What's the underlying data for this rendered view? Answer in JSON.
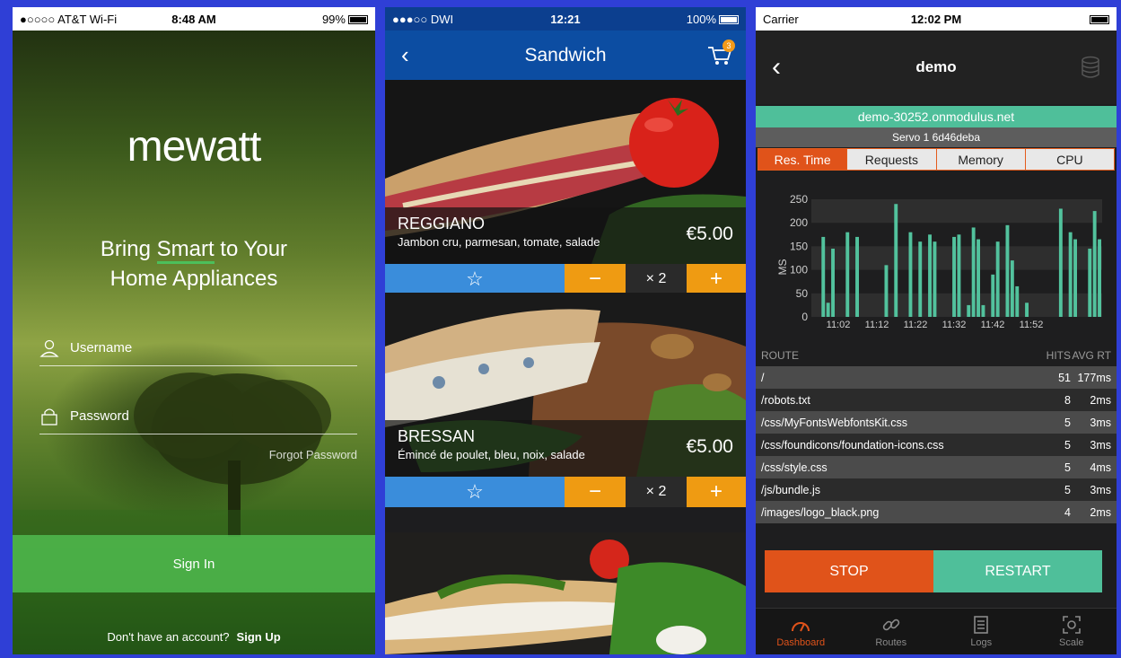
{
  "colors": {
    "background": "#2f3fd6",
    "mewatt_green": "#4cbf5b",
    "sandwich_blue": "#0c4da2",
    "sandwich_orange": "#ef9b12",
    "modulus_orange": "#e0531a",
    "modulus_teal": "#4fbf9a"
  },
  "mewatt": {
    "status": {
      "carrier": "●○○○○ AT&T Wi-Fi",
      "time": "8:48 AM",
      "battery": "99%"
    },
    "logo": "mewatt",
    "tagline_line1_pre": "Bring ",
    "tagline_highlight": "Smart",
    "tagline_line1_post": " to Your",
    "tagline_line2": "Home Appliances",
    "username_placeholder": "Username",
    "password_placeholder": "Password",
    "forgot": "Forgot Password",
    "signin": "Sign In",
    "signup_prompt": "Don't have an account?",
    "signup_link": "Sign Up"
  },
  "sandwich": {
    "status": {
      "carrier": "●●●○○ DWI",
      "time": "12:21",
      "battery": "100%"
    },
    "title": "Sandwich",
    "cart_count": "3",
    "products": [
      {
        "name": "REGGIANO",
        "desc": "Jambon cru, parmesan, tomate, salade",
        "price": "€5.00",
        "qty": "× 2"
      },
      {
        "name": "BRESSAN",
        "desc": "Émincé de poulet, bleu, noix, salade",
        "price": "€5.00",
        "qty": "× 2"
      }
    ],
    "minus": "−",
    "plus": "+",
    "star": "☆"
  },
  "modulus": {
    "status": {
      "carrier": "Carrier",
      "time": "12:02 PM"
    },
    "title": "demo",
    "host": "demo-30252.onmodulus.net",
    "servo": "Servo 1 6d46deba",
    "tabs": [
      "Res. Time",
      "Requests",
      "Memory",
      "CPU"
    ],
    "table_headers": {
      "route": "ROUTE",
      "hits": "HITS",
      "avg": "AVG RT"
    },
    "rows": [
      {
        "route": "/",
        "hits": "51",
        "avg": "177ms"
      },
      {
        "route": "/robots.txt",
        "hits": "8",
        "avg": "2ms"
      },
      {
        "route": "/css/MyFontsWebfontsKit.css",
        "hits": "5",
        "avg": "3ms"
      },
      {
        "route": "/css/foundicons/foundation-icons.css",
        "hits": "5",
        "avg": "3ms"
      },
      {
        "route": "/css/style.css",
        "hits": "5",
        "avg": "4ms"
      },
      {
        "route": "/js/bundle.js",
        "hits": "5",
        "avg": "3ms"
      },
      {
        "route": "/images/logo_black.png",
        "hits": "4",
        "avg": "2ms"
      }
    ],
    "stop": "STOP",
    "restart": "RESTART",
    "tabbar": [
      "Dashboard",
      "Routes",
      "Logs",
      "Scale"
    ]
  },
  "chart_data": {
    "type": "bar",
    "title": "",
    "xlabel": "",
    "ylabel": "MS",
    "ylim": [
      0,
      250
    ],
    "yticks": [
      0,
      50,
      100,
      150,
      200,
      250
    ],
    "x_tick_labels": [
      "11:02",
      "11:12",
      "11:22",
      "11:32",
      "11:42",
      "11:52"
    ],
    "values": [
      0,
      0,
      170,
      30,
      145,
      0,
      0,
      180,
      0,
      170,
      0,
      0,
      0,
      0,
      0,
      110,
      0,
      240,
      0,
      0,
      180,
      0,
      160,
      0,
      175,
      160,
      0,
      0,
      0,
      170,
      175,
      0,
      25,
      190,
      165,
      25,
      0,
      90,
      160,
      0,
      195,
      120,
      65,
      0,
      30,
      0,
      0,
      0,
      0,
      0,
      0,
      230,
      0,
      180,
      165,
      0,
      0,
      145,
      225,
      165
    ]
  }
}
